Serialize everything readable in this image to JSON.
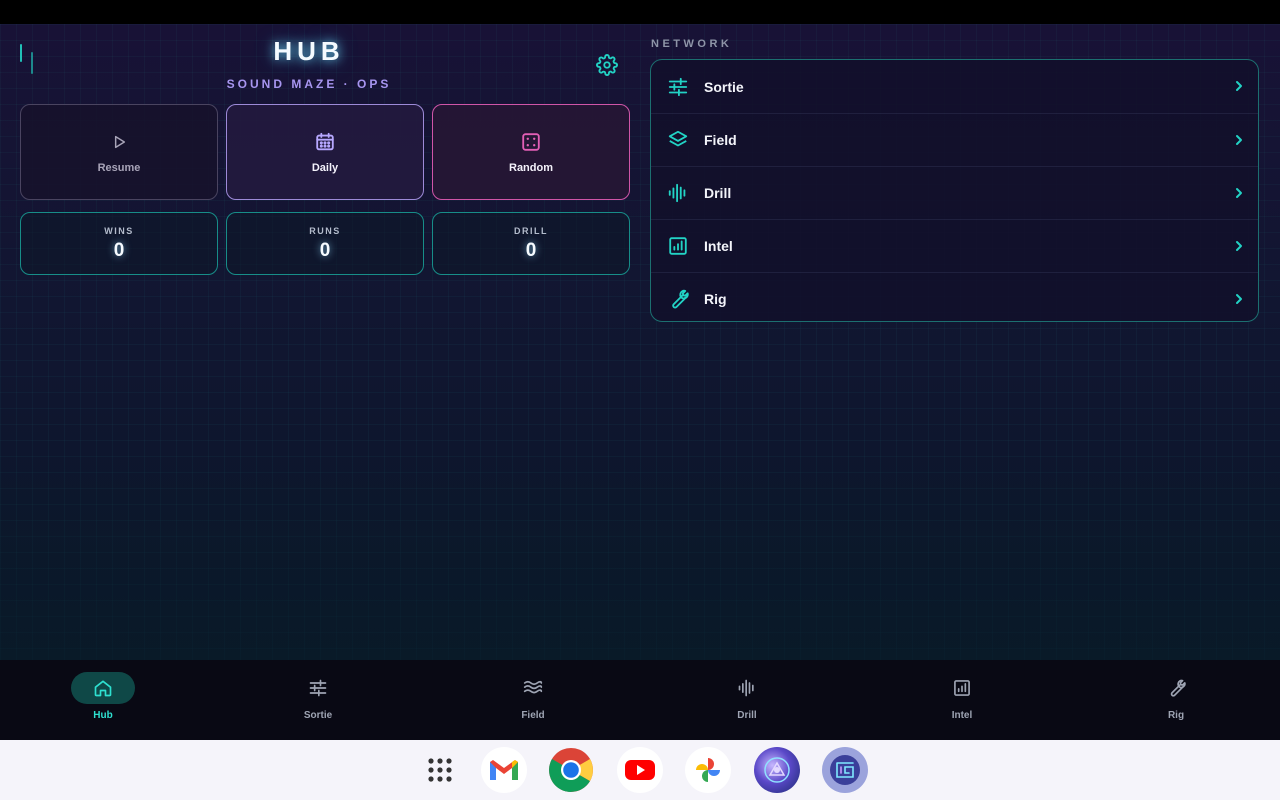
{
  "header": {
    "title": "HUB",
    "subtitle": "SOUND MAZE · OPS"
  },
  "modes": [
    {
      "label": "Resume",
      "icon": "play-icon"
    },
    {
      "label": "Daily",
      "icon": "calendar-icon"
    },
    {
      "label": "Random",
      "icon": "dice-icon"
    }
  ],
  "stats": [
    {
      "label": "WINS",
      "value": "0"
    },
    {
      "label": "RUNS",
      "value": "0"
    },
    {
      "label": "DRILL",
      "value": "0"
    }
  ],
  "network": {
    "label": "NETWORK",
    "items": [
      {
        "label": "Sortie",
        "icon": "sliders-icon"
      },
      {
        "label": "Field",
        "icon": "layers-icon"
      },
      {
        "label": "Drill",
        "icon": "waveform-icon"
      },
      {
        "label": "Intel",
        "icon": "bar-chart-icon"
      },
      {
        "label": "Rig",
        "icon": "wrench-icon"
      }
    ]
  },
  "nav": {
    "items": [
      {
        "label": "Hub",
        "icon": "home-icon",
        "active": true
      },
      {
        "label": "Sortie",
        "icon": "sliders-icon"
      },
      {
        "label": "Field",
        "icon": "waves-icon"
      },
      {
        "label": "Drill",
        "icon": "waveform-icon"
      },
      {
        "label": "Intel",
        "icon": "bar-chart-icon"
      },
      {
        "label": "Rig",
        "icon": "wrench-icon"
      }
    ]
  },
  "dock": {
    "apps": [
      "app-drawer-icon",
      "gmail-icon",
      "chrome-icon",
      "youtube-icon",
      "photos-icon",
      "game-app-icon",
      "maze-app-icon"
    ]
  },
  "colors": {
    "accent": "#22d3c5",
    "daily_border": "#9d8ad8",
    "random_border": "#d055a8",
    "subtitle": "#a796f0"
  }
}
